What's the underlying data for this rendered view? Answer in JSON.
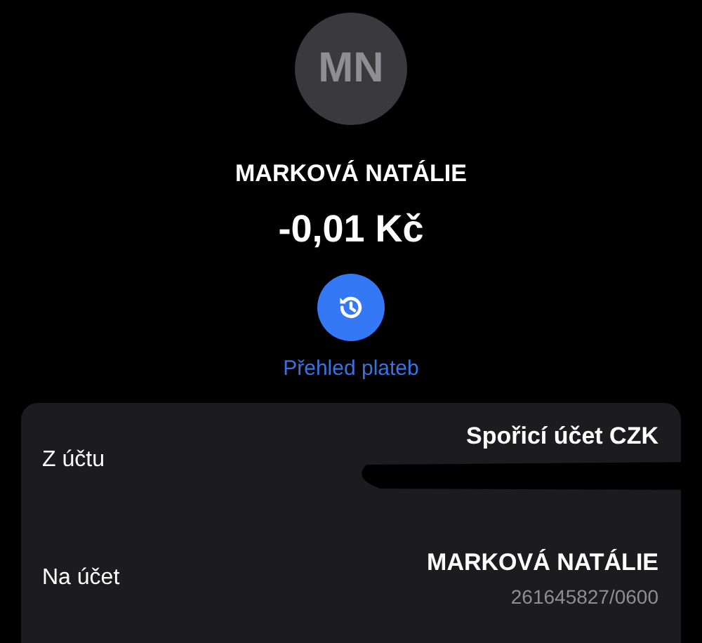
{
  "contact": {
    "initials": "MN",
    "name": "MARKOVÁ NATÁLIE",
    "amount": "-0,01 Kč"
  },
  "history_link": {
    "label": "Přehled plateb"
  },
  "details": [
    {
      "label": "Z účtu",
      "value": "Spořicí účet CZK",
      "redacted": true
    },
    {
      "label": "Na účet",
      "value": "MARKOVÁ NATÁLIE",
      "subvalue": "261645827/0600",
      "redacted": false
    }
  ]
}
